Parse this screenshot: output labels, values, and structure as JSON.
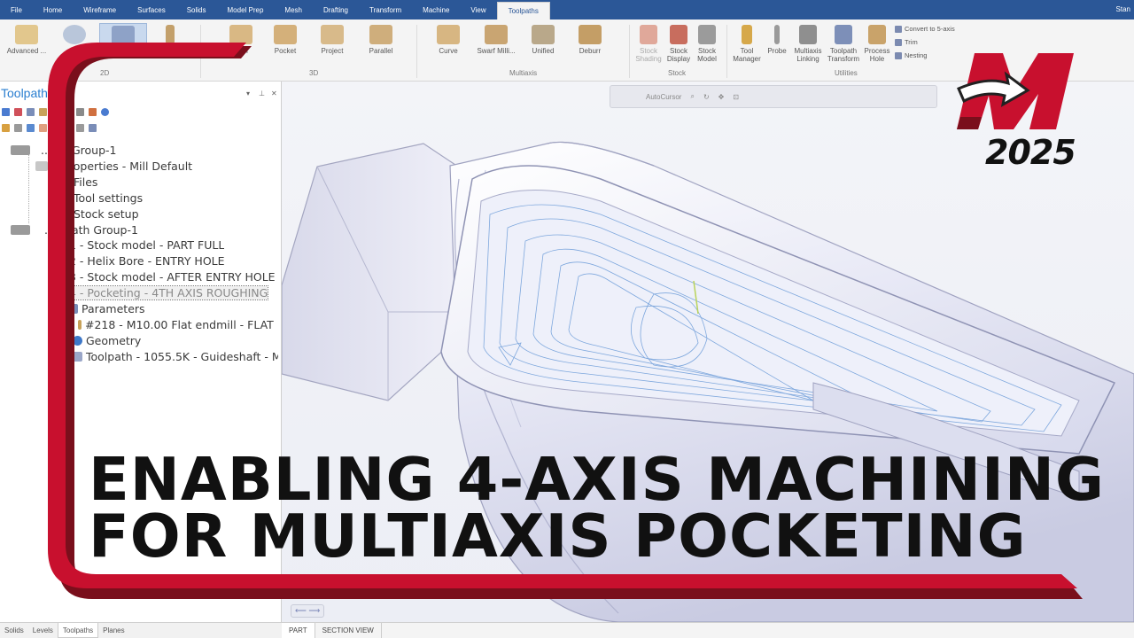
{
  "ribbon": {
    "tabs": [
      "File",
      "Home",
      "Wireframe",
      "Surfaces",
      "Solids",
      "Model Prep",
      "Mesh",
      "Drafting",
      "Transform",
      "Machine",
      "View",
      "Toolpaths"
    ],
    "active_tab": "Toolpaths",
    "user_label": "Stan",
    "groups": {
      "g2d": "2D",
      "g3d": "3D",
      "multiaxis": "Multiaxis",
      "stock": "Stock",
      "utilities": "Utilities"
    },
    "buttons": {
      "advanced": "Advanced ...",
      "rough": "...gh",
      "pocket": "Pocket",
      "project": "Project",
      "parallel": "Parallel",
      "curve": "Curve",
      "swarf": "Swarf Milli...",
      "unified": "Unified",
      "deburr": "Deburr",
      "stock_shading": "Stock Shading",
      "stock_display": "Stock Display",
      "stock_model": "Stock Model",
      "tool_manager": "Tool Manager",
      "probe": "Probe",
      "multiaxis_linking": "Multiaxis Linking",
      "toolpath_transform": "Toolpath Transform",
      "process_hole": "Process Hole",
      "convert_5axis": "Convert to 5-axis",
      "trim": "Trim",
      "nesting": "Nesting"
    }
  },
  "manager": {
    "title": "Toolpaths",
    "tree": [
      "...ine Group-1",
      "...roperties - Mill Default",
      "Files",
      "Tool settings",
      "Stock setup",
      "...olpath Group-1",
      "1 - Stock model - PART FULL",
      "2 - Helix Bore - ENTRY HOLE",
      "3 - Stock model - AFTER ENTRY HOLE",
      "4 - Pocketing - 4TH AXIS ROUGHING",
      "Parameters",
      "#218 - M10.00 Flat endmill - FLAT",
      "Geometry",
      "Toolpath - 1055.5K - Guideshaft - M"
    ],
    "bottom_tabs": [
      "Solids",
      "Levels",
      "Toolpaths",
      "Planes"
    ],
    "active_bottom_tab": "Toolpaths"
  },
  "viewport": {
    "autocursor": "AutoCursor",
    "view_tabs": [
      "PART",
      "SECTION VIEW"
    ]
  },
  "overlay": {
    "headline_line1": "ENABLING 4-AXIS MACHINING",
    "headline_line2": "FOR MULTIAXIS POCKETING",
    "logo_letter": "M",
    "logo_year": "2025"
  },
  "colors": {
    "accent_red": "#c8102e",
    "ribbon_blue": "#2b5797",
    "toolpath_blue": "#6b9bd8"
  }
}
